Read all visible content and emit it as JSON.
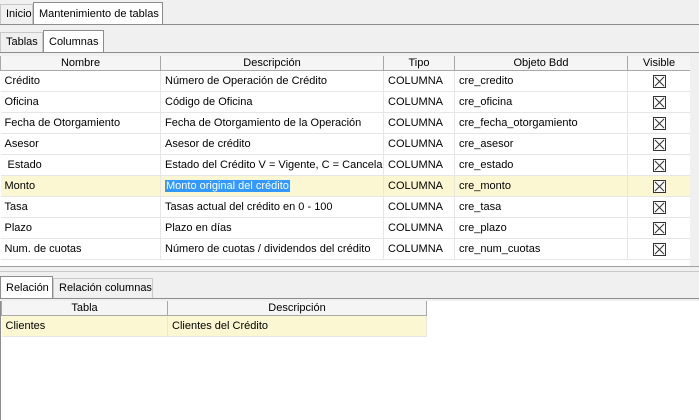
{
  "main_tabs": [
    "Inicio",
    "Mantenimiento de tablas"
  ],
  "sub_tabs": [
    "Tablas",
    "Columnas"
  ],
  "columns_grid": {
    "headers": [
      "Nombre",
      "Descripción",
      "Tipo",
      "Objeto Bdd",
      "Visible"
    ],
    "rows": [
      {
        "nombre": "Crédito",
        "descripcion": "Número de Operación de Crédito",
        "tipo": "COLUMNA",
        "objeto": "cre_credito",
        "visible": true
      },
      {
        "nombre": "Oficina",
        "descripcion": "Código de Oficina",
        "tipo": "COLUMNA",
        "objeto": "cre_oficina",
        "visible": true
      },
      {
        "nombre": "Fecha de Otorgamiento",
        "descripcion": "Fecha de Otorgamiento de la Operación",
        "tipo": "COLUMNA",
        "objeto": "cre_fecha_otorgamiento",
        "visible": true
      },
      {
        "nombre": "Asesor",
        "descripcion": "Asesor de crédito",
        "tipo": "COLUMNA",
        "objeto": "cre_asesor",
        "visible": true
      },
      {
        "nombre": " Estado",
        "descripcion": "Estado del Crédito V = Vigente, C = Cancelado",
        "tipo": "COLUMNA",
        "objeto": "cre_estado",
        "visible": true
      },
      {
        "nombre": "Monto",
        "descripcion": "Monto original del crédito",
        "tipo": "COLUMNA",
        "objeto": "cre_monto",
        "visible": true
      },
      {
        "nombre": "Tasa",
        "descripcion": "Tasas actual del crédito en 0 - 100",
        "tipo": "COLUMNA",
        "objeto": "cre_tasa",
        "visible": true
      },
      {
        "nombre": "Plazo",
        "descripcion": "Plazo en días",
        "tipo": "COLUMNA",
        "objeto": "cre_plazo",
        "visible": true
      },
      {
        "nombre": "Num. de cuotas",
        "descripcion": "Número de cuotas / dividendos del crédito",
        "tipo": "COLUMNA",
        "objeto": "cre_num_cuotas",
        "visible": true
      }
    ]
  },
  "relation_tabs": [
    "Relación",
    "Relación columnas"
  ],
  "relation_grid": {
    "headers": [
      "Tabla",
      "Descripción"
    ],
    "rows": [
      {
        "tabla": "Clientes",
        "descripcion": "Clientes del Crédito"
      }
    ]
  }
}
